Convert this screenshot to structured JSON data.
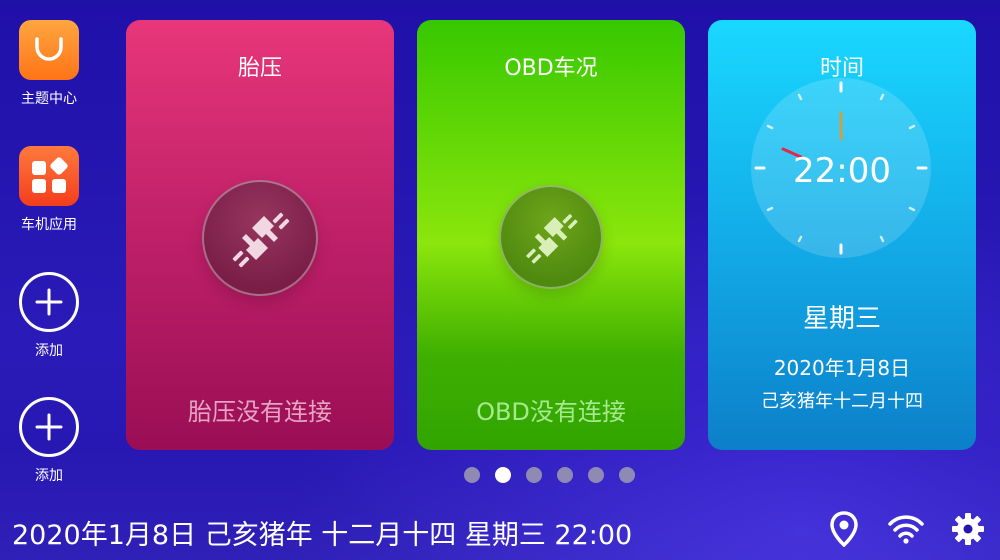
{
  "sidebar": {
    "items": [
      {
        "label": "主题中心",
        "icon": "theme-center-icon"
      },
      {
        "label": "车机应用",
        "icon": "car-apps-icon"
      },
      {
        "label": "添加",
        "icon": "add-icon"
      },
      {
        "label": "添加",
        "icon": "add-icon"
      }
    ]
  },
  "cards": {
    "tire": {
      "title": "胎压",
      "status": "胎压没有连接",
      "icon": "plug-disconnected-icon",
      "color": "#d42a6f"
    },
    "obd": {
      "title": "OBD车况",
      "status": "OBD没有连接",
      "icon": "plug-disconnected-icon",
      "color": "#4fd100"
    },
    "time": {
      "title": "时间",
      "clock_time": "22:00",
      "weekday": "星期三",
      "date": "2020年1月8日",
      "lunar": "己亥猪年十二月十四",
      "color": "#17b8f0"
    }
  },
  "pager": {
    "count": 6,
    "active_index": 1
  },
  "status_bar": {
    "text": "2020年1月8日 己亥猪年 十二月十四 星期三 22:00",
    "icons": [
      "location-icon",
      "wifi-icon",
      "settings-gear-icon"
    ]
  }
}
